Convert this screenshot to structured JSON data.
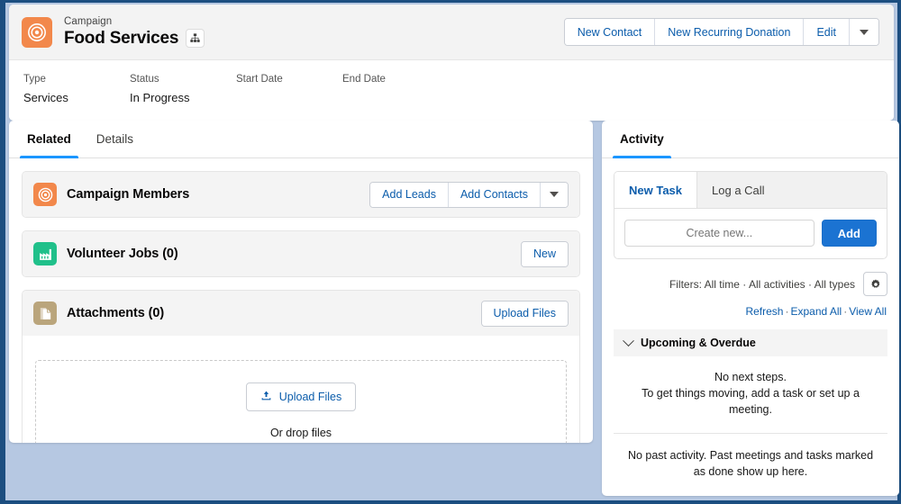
{
  "record_header": {
    "entity_icon": "campaign-target-icon",
    "eyebrow": "Campaign",
    "title": "Food Services",
    "hierarchy_icon": "hierarchy-icon",
    "actions": [
      {
        "label": "New Contact",
        "name": "new-contact-button"
      },
      {
        "label": "New Recurring Donation",
        "name": "new-recurring-donation-button"
      },
      {
        "label": "Edit",
        "name": "edit-button"
      }
    ],
    "more_actions_icon": "chevron-down-icon",
    "fields": [
      {
        "label": "Type",
        "value": "Services"
      },
      {
        "label": "Status",
        "value": "In Progress"
      },
      {
        "label": "Start Date",
        "value": ""
      },
      {
        "label": "End Date",
        "value": ""
      }
    ]
  },
  "main": {
    "tabs": [
      {
        "label": "Related",
        "active": true
      },
      {
        "label": "Details",
        "active": false
      }
    ],
    "cards": [
      {
        "title": "Campaign Members",
        "icon": "campaign-target-icon",
        "icon_class": "campaign",
        "actions": [
          {
            "label": "Add Leads",
            "name": "add-leads-button"
          },
          {
            "label": "Add Contacts",
            "name": "add-contacts-button"
          }
        ],
        "has_caret": true
      },
      {
        "title": "Volunteer Jobs (0)",
        "icon": "volunteer-jobs-icon",
        "icon_class": "volunteer",
        "actions": [
          {
            "label": "New",
            "name": "new-volunteer-job-button"
          }
        ],
        "has_caret": false
      },
      {
        "title": "Attachments (0)",
        "icon": "attachment-document-icon",
        "icon_class": "attachment",
        "actions": [
          {
            "label": "Upload Files",
            "name": "upload-files-header-button"
          }
        ],
        "has_caret": false
      }
    ],
    "dropzone": {
      "upload_label": "Upload Files",
      "upload_icon": "upload-arrow-icon",
      "drop_text": "Or drop files"
    }
  },
  "activity": {
    "panel_tabs": [
      {
        "label": "Activity",
        "active": true
      }
    ],
    "composer": {
      "tabs": [
        {
          "label": "New Task",
          "active": true
        },
        {
          "label": "Log a Call",
          "active": false
        }
      ],
      "input_placeholder": "Create new...",
      "input_value": "",
      "add_label": "Add"
    },
    "filters_text": "Filters: All time · All activities · All types",
    "filter_settings_icon": "gear-icon",
    "links": [
      {
        "label": "Refresh",
        "name": "refresh-link"
      },
      {
        "label": "Expand All",
        "name": "expand-all-link"
      },
      {
        "label": "View All",
        "name": "view-all-link"
      }
    ],
    "link_separator": "·",
    "section": {
      "label": "Upcoming & Overdue",
      "chevron_icon": "chevron-down-icon"
    },
    "empty_next_steps_line1": "No next steps.",
    "empty_next_steps_line2": "To get things moving, add a task or set up a meeting.",
    "empty_past_activity": "No past activity. Past meetings and tasks marked as done show up here."
  },
  "colors": {
    "brand_blue": "#1b73d2",
    "link_blue": "#0b5cab",
    "tab_underline": "#1b96ff",
    "campaign_orange": "#f2884b",
    "volunteer_green": "#20c08a",
    "attachment_tan": "#baa57c",
    "page_background": "#b6c8e2",
    "window_border": "#1c4e80"
  }
}
